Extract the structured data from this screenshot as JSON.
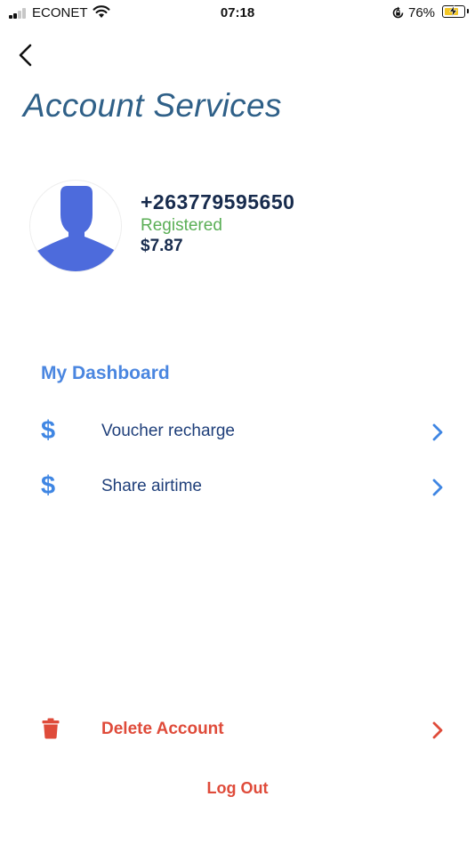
{
  "status_bar": {
    "carrier": "ECONET",
    "time": "07:18",
    "battery_percent": "76%",
    "battery_level": 0.76,
    "icons": [
      "signal-icon",
      "wifi-icon",
      "orientation-lock-icon",
      "battery-charging-icon"
    ]
  },
  "header": {
    "back_icon": "chevron-left-icon",
    "title": "Account Services"
  },
  "profile": {
    "avatar_icon": "person-silhouette-icon",
    "phone": "+263779595650",
    "status": "Registered",
    "balance": "$7.87"
  },
  "dashboard": {
    "title": "My Dashboard",
    "items": [
      {
        "icon": "dollar-icon",
        "label": "Voucher recharge"
      },
      {
        "icon": "dollar-icon",
        "label": "Share airtime"
      }
    ]
  },
  "account_actions": {
    "delete_label": "Delete Account",
    "delete_icon": "trash-icon",
    "logout_label": "Log Out"
  },
  "colors": {
    "title": "#2f6088",
    "accent_blue": "#4a86e0",
    "registered_green": "#5aae55",
    "danger_red": "#df4b3a",
    "dark_navy": "#172b4d",
    "avatar_blue": "#4d6bdc"
  }
}
